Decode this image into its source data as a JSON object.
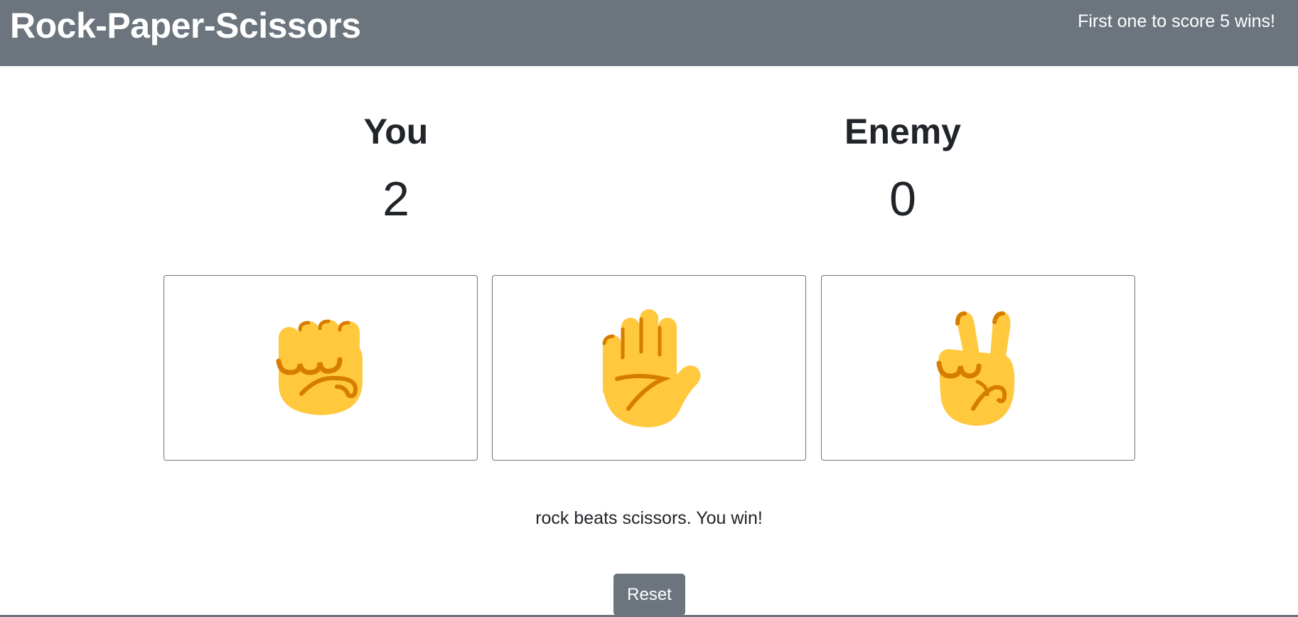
{
  "header": {
    "title": "Rock-Paper-Scissors",
    "tagline": "First one to score 5 wins!"
  },
  "players": {
    "you": {
      "name": "You",
      "score": "2"
    },
    "enemy": {
      "name": "Enemy",
      "score": "0"
    }
  },
  "choices": [
    {
      "id": "rock",
      "icon": "raised-fist-icon"
    },
    {
      "id": "paper",
      "icon": "raised-hand-icon"
    },
    {
      "id": "scissors",
      "icon": "victory-hand-icon"
    }
  ],
  "result": "rock beats scissors. You win!",
  "reset_label": "Reset",
  "colors": {
    "header_bg": "#6c757d",
    "text": "#212529",
    "emoji_fill": "#ffc83d",
    "emoji_shade": "#d67d00"
  }
}
